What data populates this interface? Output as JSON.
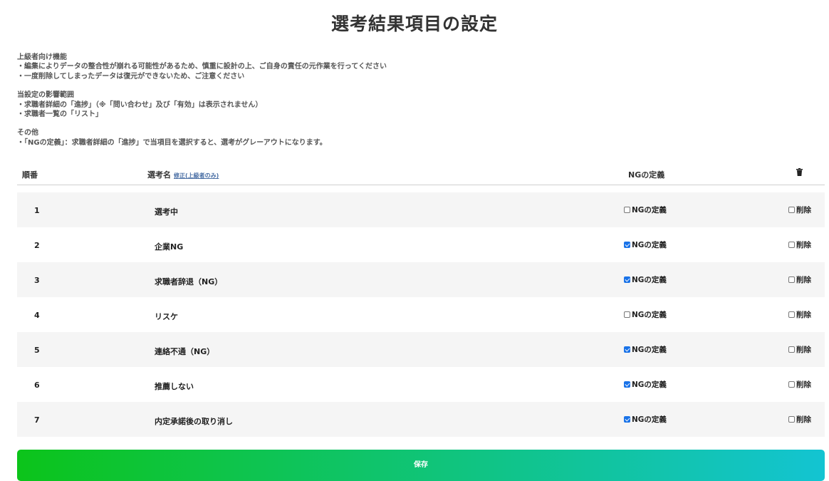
{
  "title": "選考結果項目の設定",
  "notes": {
    "advanced_heading": "上級者向け機能",
    "advanced_1": "・編集によりデータの整合性が崩れる可能性があるため、慎重に設計の上、ご自身の責任の元作業を行ってください",
    "advanced_2": "・一度削除してしまったデータは復元ができないため、ご注意ください",
    "scope_heading": "当設定の影響範囲",
    "scope_1": "・求職者詳細の「進捗」（※「問い合わせ」及び「有効」は表示されません）",
    "scope_2": "・求職者一覧の「リスト」",
    "other_heading": "その他",
    "other_1": "・「NGの定義」：求職者詳細の「進捗」で当項目を選択すると、選考がグレーアウトになります。"
  },
  "table": {
    "col_order": "順番",
    "col_name": "選考名",
    "edit_link": "修正(上級者のみ)",
    "col_ng": "NGの定義",
    "trash_icon": "trash-icon",
    "ng_label": "NGの定義",
    "delete_label": "削除",
    "rows": [
      {
        "order": "1",
        "name": "選考中",
        "ng": false,
        "delete": false
      },
      {
        "order": "2",
        "name": "企業NG",
        "ng": true,
        "delete": false
      },
      {
        "order": "3",
        "name": "求職者辞退（NG）",
        "ng": true,
        "delete": false
      },
      {
        "order": "4",
        "name": "リスケ",
        "ng": false,
        "delete": false
      },
      {
        "order": "5",
        "name": "連絡不通（NG）",
        "ng": true,
        "delete": false
      },
      {
        "order": "6",
        "name": "推薦しない",
        "ng": true,
        "delete": false
      },
      {
        "order": "7",
        "name": "内定承諾後の取り消し",
        "ng": true,
        "delete": false
      }
    ]
  },
  "save_label": "保存",
  "colors": {
    "checkbox_checked": "#1a73e8",
    "save_gradient_start": "#0cc41a",
    "save_gradient_end": "#13c4d2",
    "row_alt": "#f5f5f5"
  }
}
